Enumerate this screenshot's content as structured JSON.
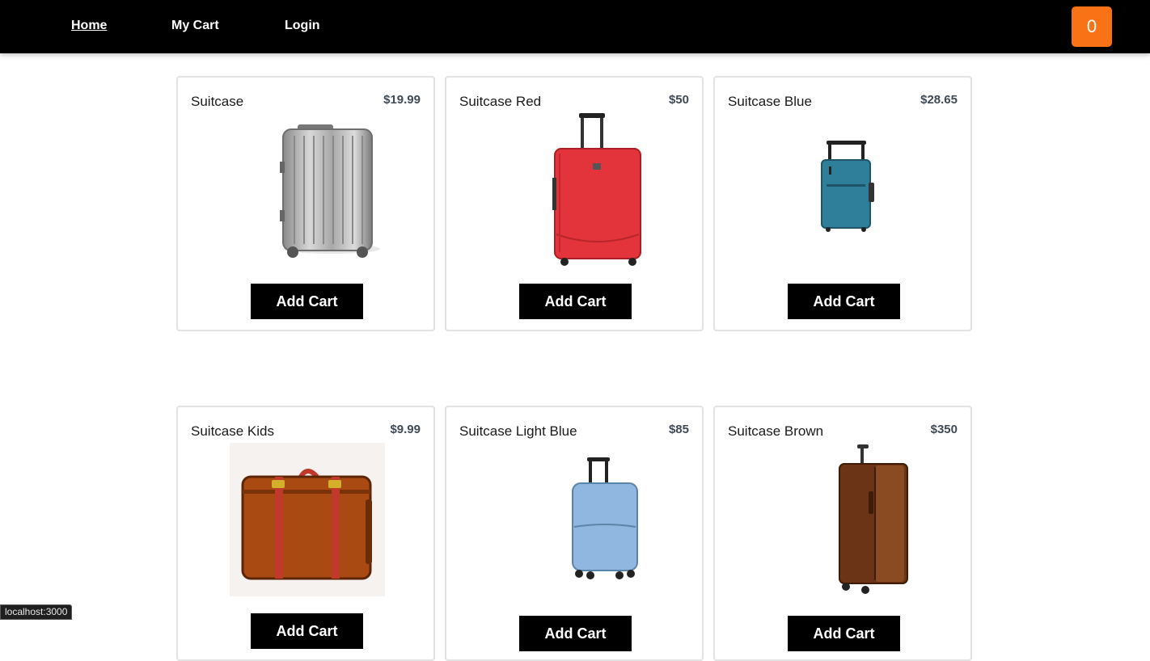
{
  "nav": {
    "home": "Home",
    "cart": "My Cart",
    "login": "Login",
    "cart_count": "0"
  },
  "products": [
    {
      "name": "Suitcase",
      "price": "$19.99",
      "button": "Add Cart",
      "image": "silver-suitcase-icon"
    },
    {
      "name": "Suitcase Red",
      "price": "$50",
      "button": "Add Cart",
      "image": "red-suitcase-icon"
    },
    {
      "name": "Suitcase Blue",
      "price": "$28.65",
      "button": "Add Cart",
      "image": "teal-suitcase-icon"
    },
    {
      "name": "Suitcase Kids",
      "price": "$9.99",
      "button": "Add Cart",
      "image": "vintage-suitcase-icon"
    },
    {
      "name": "Suitcase Light Blue",
      "price": "$85",
      "button": "Add Cart",
      "image": "light-blue-suitcase-icon"
    },
    {
      "name": "Suitcase Brown",
      "price": "$350",
      "button": "Add Cart",
      "image": "brown-suitcase-icon"
    }
  ],
  "status_bar": "localhost:3000",
  "colors": {
    "navbar": "#000000",
    "cart_badge": "#f97316",
    "button": "#000000",
    "card_border": "#e2e2e2"
  }
}
